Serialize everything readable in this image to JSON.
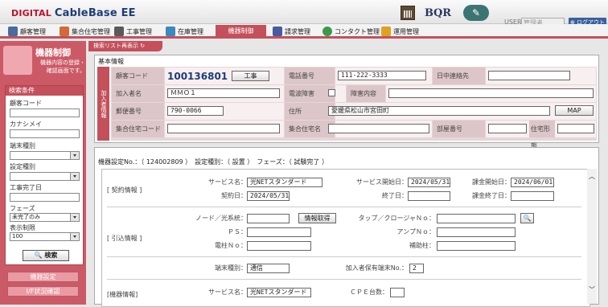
{
  "app": {
    "logo_prefix": "DIGITAL",
    "logo_main": "CableBase",
    "logo_suffix": "EE",
    "bqr": "BQR",
    "user_label": "USER",
    "user_placeholder": "管理者",
    "logout": "ログアウト"
  },
  "tabs": [
    "顧客管理",
    "集合住宅管理",
    "工事管理",
    "在庫管理",
    "機器制御",
    "請求管理",
    "コンタクト管理",
    "運用管理"
  ],
  "sidebar": {
    "title": "機器制御",
    "subtitle": "機器内容の登録・確認画面です。",
    "conditions_title": "検索条件",
    "fields": {
      "customer_code": "顧客コード",
      "kana": "カナシメイ",
      "terminal_type": "端末種別",
      "setting_type": "設定種別",
      "work_done": "工事完了日",
      "phase": "フェーズ",
      "phase_value": "未完了のみ",
      "display": "表示制限",
      "display_value": "100"
    },
    "search": "検索",
    "nav": [
      "機器設定",
      "I/F状況確認"
    ]
  },
  "main": {
    "reload": "検索リスト再表示",
    "basic_title": "基本情報",
    "vertical": "加入者情報",
    "labels": {
      "customer_code": "顧客コード",
      "phone": "電話番号",
      "daytime": "日中連絡先",
      "name": "加入者名",
      "radio": "電波障害",
      "obstacle": "障害内容",
      "zip": "郵便番号",
      "address": "住所",
      "building_code": "集合住宅コード",
      "building_name": "集合住宅名",
      "room": "部屋番号",
      "housing": "住宅形態"
    },
    "values": {
      "customer_code": "100136801",
      "phone": "111-222-3333",
      "name": "ＭＭＯ１",
      "zip": "790-0066",
      "address": "愛媛県松山市宮田町"
    },
    "buttons": {
      "work": "工事",
      "map": "MAP"
    },
    "device_line": "機器設定No.：（ 124002809 ）　設定種別：（ 設置 ）　フェーズ：（ 試験完了 ）",
    "contract": {
      "title": "[ 契約情報 ]",
      "service": "サービス名：",
      "service_val": "光NETスタンダード",
      "start": "サービス開始日：",
      "start_val": "2024/05/31",
      "bill_start": "課金開始日：",
      "bill_start_val": "2024/06/01",
      "contract_day": "契約日：",
      "contract_day_val": "2024/05/31",
      "end": "終了日：",
      "bill_end": "課金終了日："
    },
    "wire": {
      "title": "[ 引込情報 ]",
      "node": "ノード／光系統：",
      "fetch": "情報取得",
      "tap": "タップ／クロージャＮｏ：",
      "ps": "ＰＳ：",
      "amp": "アンプＮｏ：",
      "pole": "電柱Ｎｏ：",
      "aux": "補助柱："
    },
    "terminal": {
      "type": "端末種別：",
      "type_val": "通信",
      "count": "加入者保有端末No.：",
      "count_val": "2"
    },
    "device": {
      "title": "[機器情報]",
      "service": "サービス名：",
      "service_val": "光NETスタンダード",
      "cpe": "ＣＰＥ台数："
    }
  }
}
